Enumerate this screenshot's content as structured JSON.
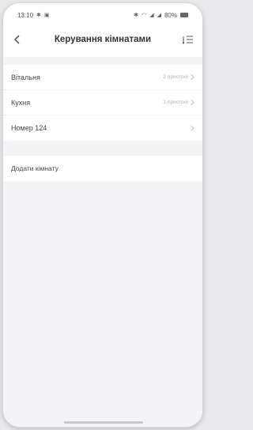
{
  "status_bar": {
    "time": "13:10",
    "battery": "80%"
  },
  "header": {
    "title": "Керування кімнатами",
    "back_icon": "chevron-left-icon",
    "sort_icon": "sort-list-icon"
  },
  "rooms": [
    {
      "name": "Вітальня",
      "devices": "2 пристрої"
    },
    {
      "name": "Кухня",
      "devices": "1 пристрої"
    },
    {
      "name": "Номер 124",
      "devices": ""
    }
  ],
  "add_room": {
    "label": "Додати кімнату"
  },
  "colors": {
    "background": "#f4f4f6",
    "card": "#ffffff",
    "text": "#333333",
    "muted": "#b0b0b4"
  }
}
